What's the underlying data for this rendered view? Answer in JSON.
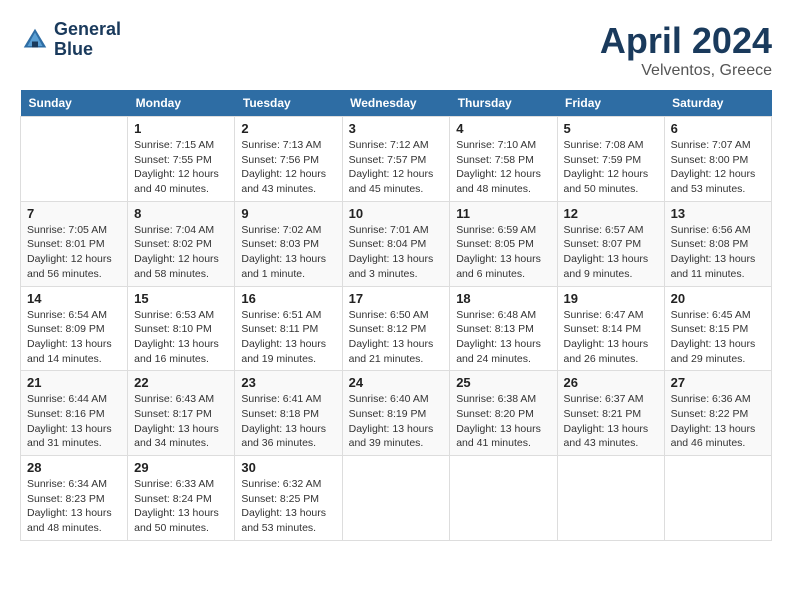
{
  "header": {
    "logo_line1": "General",
    "logo_line2": "Blue",
    "month_year": "April 2024",
    "location": "Velventos, Greece"
  },
  "days_of_week": [
    "Sunday",
    "Monday",
    "Tuesday",
    "Wednesday",
    "Thursday",
    "Friday",
    "Saturday"
  ],
  "weeks": [
    [
      {
        "day": "",
        "sunrise": "",
        "sunset": "",
        "daylight": ""
      },
      {
        "day": "1",
        "sunrise": "Sunrise: 7:15 AM",
        "sunset": "Sunset: 7:55 PM",
        "daylight": "Daylight: 12 hours and 40 minutes."
      },
      {
        "day": "2",
        "sunrise": "Sunrise: 7:13 AM",
        "sunset": "Sunset: 7:56 PM",
        "daylight": "Daylight: 12 hours and 43 minutes."
      },
      {
        "day": "3",
        "sunrise": "Sunrise: 7:12 AM",
        "sunset": "Sunset: 7:57 PM",
        "daylight": "Daylight: 12 hours and 45 minutes."
      },
      {
        "day": "4",
        "sunrise": "Sunrise: 7:10 AM",
        "sunset": "Sunset: 7:58 PM",
        "daylight": "Daylight: 12 hours and 48 minutes."
      },
      {
        "day": "5",
        "sunrise": "Sunrise: 7:08 AM",
        "sunset": "Sunset: 7:59 PM",
        "daylight": "Daylight: 12 hours and 50 minutes."
      },
      {
        "day": "6",
        "sunrise": "Sunrise: 7:07 AM",
        "sunset": "Sunset: 8:00 PM",
        "daylight": "Daylight: 12 hours and 53 minutes."
      }
    ],
    [
      {
        "day": "7",
        "sunrise": "Sunrise: 7:05 AM",
        "sunset": "Sunset: 8:01 PM",
        "daylight": "Daylight: 12 hours and 56 minutes."
      },
      {
        "day": "8",
        "sunrise": "Sunrise: 7:04 AM",
        "sunset": "Sunset: 8:02 PM",
        "daylight": "Daylight: 12 hours and 58 minutes."
      },
      {
        "day": "9",
        "sunrise": "Sunrise: 7:02 AM",
        "sunset": "Sunset: 8:03 PM",
        "daylight": "Daylight: 13 hours and 1 minute."
      },
      {
        "day": "10",
        "sunrise": "Sunrise: 7:01 AM",
        "sunset": "Sunset: 8:04 PM",
        "daylight": "Daylight: 13 hours and 3 minutes."
      },
      {
        "day": "11",
        "sunrise": "Sunrise: 6:59 AM",
        "sunset": "Sunset: 8:05 PM",
        "daylight": "Daylight: 13 hours and 6 minutes."
      },
      {
        "day": "12",
        "sunrise": "Sunrise: 6:57 AM",
        "sunset": "Sunset: 8:07 PM",
        "daylight": "Daylight: 13 hours and 9 minutes."
      },
      {
        "day": "13",
        "sunrise": "Sunrise: 6:56 AM",
        "sunset": "Sunset: 8:08 PM",
        "daylight": "Daylight: 13 hours and 11 minutes."
      }
    ],
    [
      {
        "day": "14",
        "sunrise": "Sunrise: 6:54 AM",
        "sunset": "Sunset: 8:09 PM",
        "daylight": "Daylight: 13 hours and 14 minutes."
      },
      {
        "day": "15",
        "sunrise": "Sunrise: 6:53 AM",
        "sunset": "Sunset: 8:10 PM",
        "daylight": "Daylight: 13 hours and 16 minutes."
      },
      {
        "day": "16",
        "sunrise": "Sunrise: 6:51 AM",
        "sunset": "Sunset: 8:11 PM",
        "daylight": "Daylight: 13 hours and 19 minutes."
      },
      {
        "day": "17",
        "sunrise": "Sunrise: 6:50 AM",
        "sunset": "Sunset: 8:12 PM",
        "daylight": "Daylight: 13 hours and 21 minutes."
      },
      {
        "day": "18",
        "sunrise": "Sunrise: 6:48 AM",
        "sunset": "Sunset: 8:13 PM",
        "daylight": "Daylight: 13 hours and 24 minutes."
      },
      {
        "day": "19",
        "sunrise": "Sunrise: 6:47 AM",
        "sunset": "Sunset: 8:14 PM",
        "daylight": "Daylight: 13 hours and 26 minutes."
      },
      {
        "day": "20",
        "sunrise": "Sunrise: 6:45 AM",
        "sunset": "Sunset: 8:15 PM",
        "daylight": "Daylight: 13 hours and 29 minutes."
      }
    ],
    [
      {
        "day": "21",
        "sunrise": "Sunrise: 6:44 AM",
        "sunset": "Sunset: 8:16 PM",
        "daylight": "Daylight: 13 hours and 31 minutes."
      },
      {
        "day": "22",
        "sunrise": "Sunrise: 6:43 AM",
        "sunset": "Sunset: 8:17 PM",
        "daylight": "Daylight: 13 hours and 34 minutes."
      },
      {
        "day": "23",
        "sunrise": "Sunrise: 6:41 AM",
        "sunset": "Sunset: 8:18 PM",
        "daylight": "Daylight: 13 hours and 36 minutes."
      },
      {
        "day": "24",
        "sunrise": "Sunrise: 6:40 AM",
        "sunset": "Sunset: 8:19 PM",
        "daylight": "Daylight: 13 hours and 39 minutes."
      },
      {
        "day": "25",
        "sunrise": "Sunrise: 6:38 AM",
        "sunset": "Sunset: 8:20 PM",
        "daylight": "Daylight: 13 hours and 41 minutes."
      },
      {
        "day": "26",
        "sunrise": "Sunrise: 6:37 AM",
        "sunset": "Sunset: 8:21 PM",
        "daylight": "Daylight: 13 hours and 43 minutes."
      },
      {
        "day": "27",
        "sunrise": "Sunrise: 6:36 AM",
        "sunset": "Sunset: 8:22 PM",
        "daylight": "Daylight: 13 hours and 46 minutes."
      }
    ],
    [
      {
        "day": "28",
        "sunrise": "Sunrise: 6:34 AM",
        "sunset": "Sunset: 8:23 PM",
        "daylight": "Daylight: 13 hours and 48 minutes."
      },
      {
        "day": "29",
        "sunrise": "Sunrise: 6:33 AM",
        "sunset": "Sunset: 8:24 PM",
        "daylight": "Daylight: 13 hours and 50 minutes."
      },
      {
        "day": "30",
        "sunrise": "Sunrise: 6:32 AM",
        "sunset": "Sunset: 8:25 PM",
        "daylight": "Daylight: 13 hours and 53 minutes."
      },
      {
        "day": "",
        "sunrise": "",
        "sunset": "",
        "daylight": ""
      },
      {
        "day": "",
        "sunrise": "",
        "sunset": "",
        "daylight": ""
      },
      {
        "day": "",
        "sunrise": "",
        "sunset": "",
        "daylight": ""
      },
      {
        "day": "",
        "sunrise": "",
        "sunset": "",
        "daylight": ""
      }
    ]
  ]
}
